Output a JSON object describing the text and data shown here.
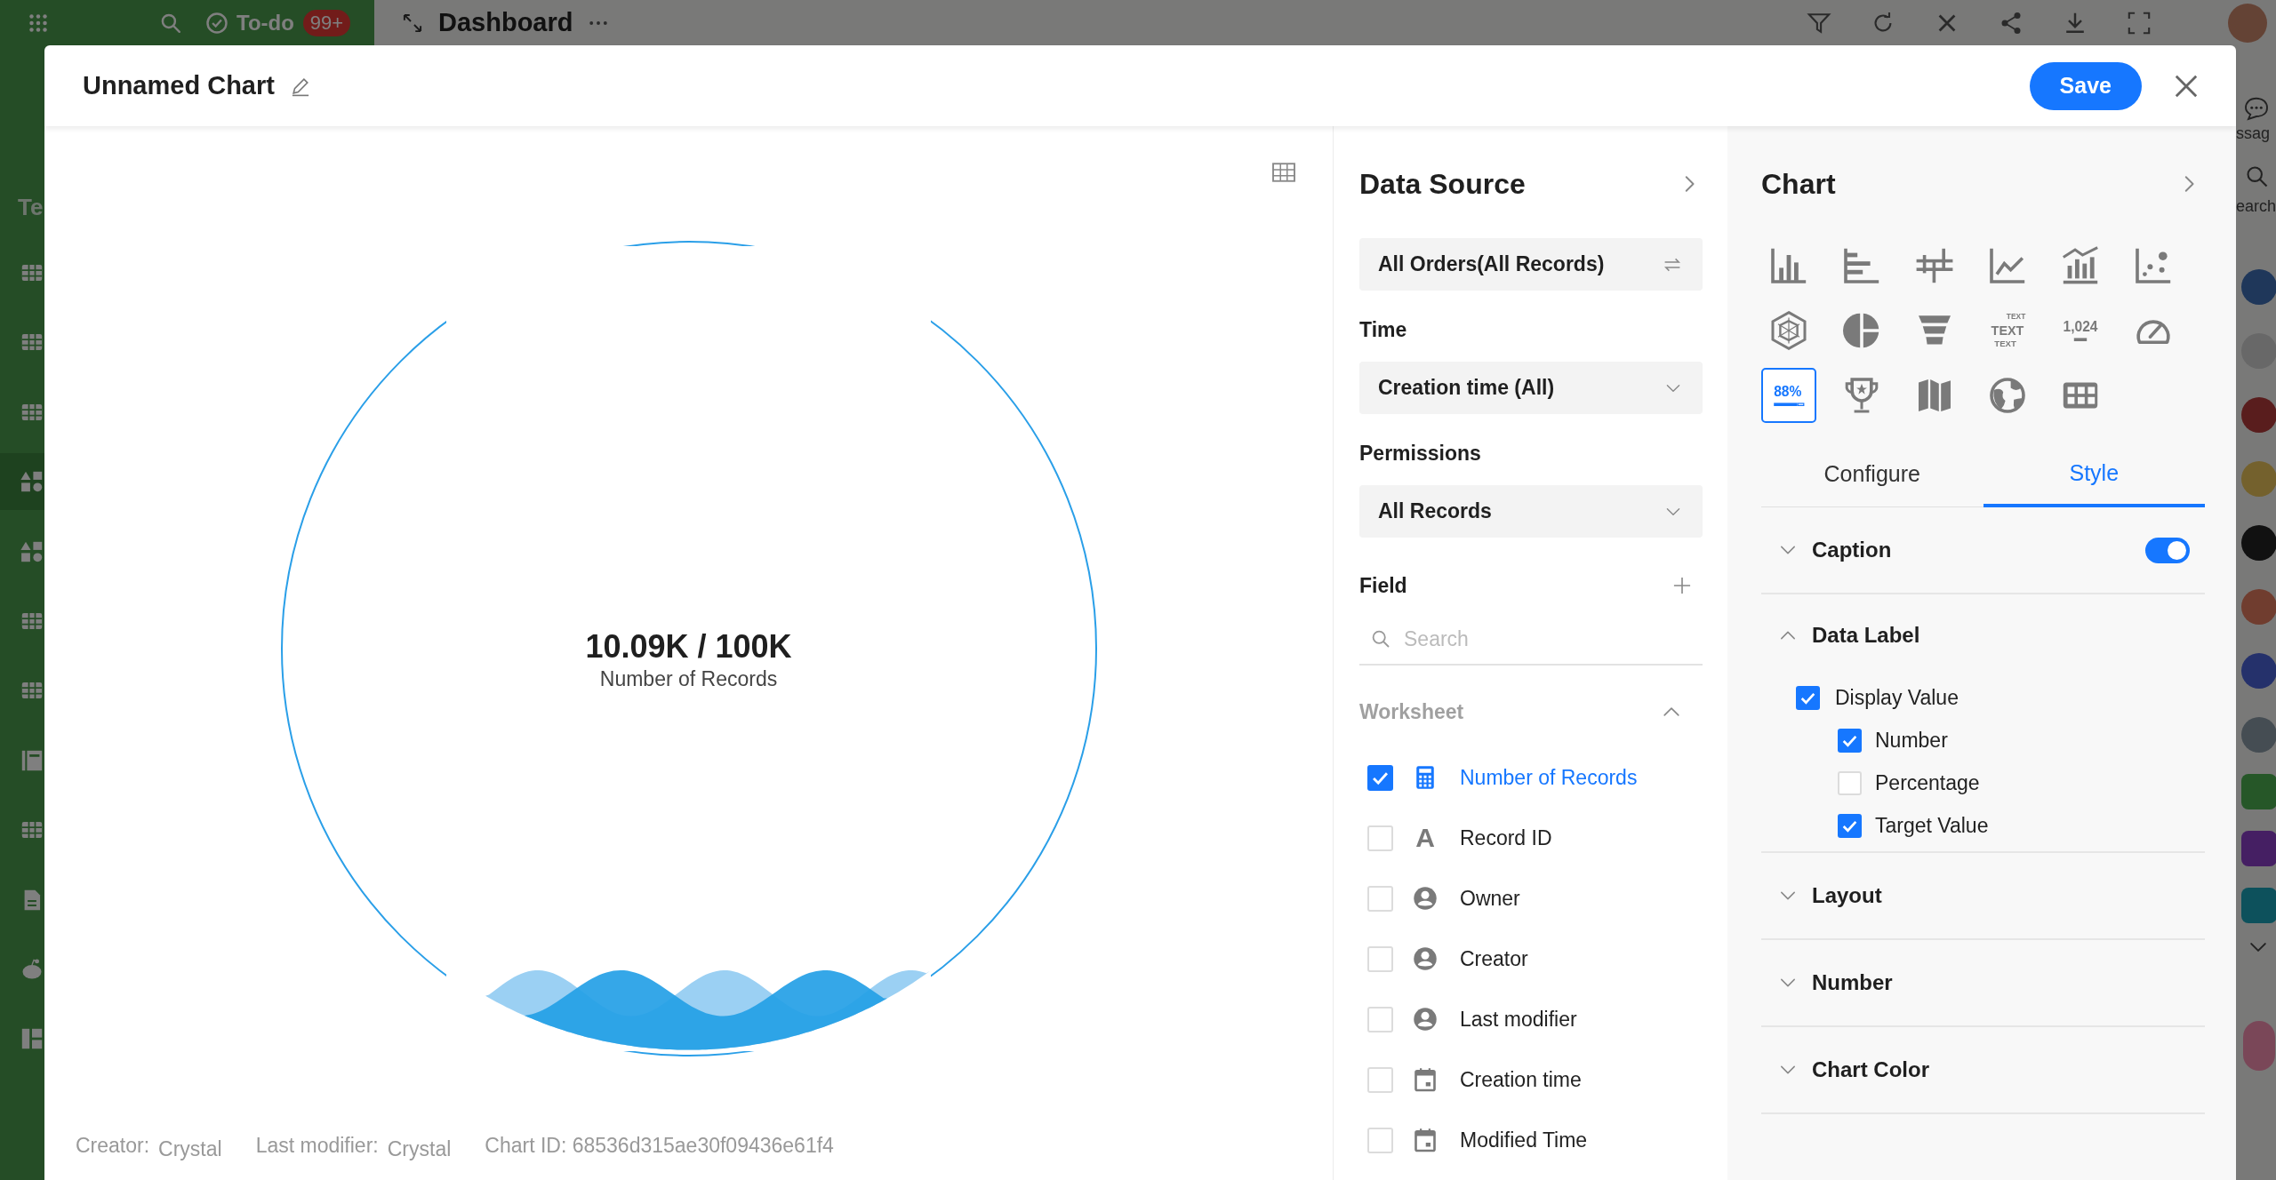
{
  "app_bar": {
    "todo": "To-do",
    "todo_badge": "99+",
    "title": "Dashboard"
  },
  "sidebar": {
    "label": "Te"
  },
  "right_rail": {
    "labels": [
      "ssag",
      "earch"
    ]
  },
  "dialog": {
    "title": "Unnamed Chart",
    "save": "Save"
  },
  "preview": {
    "value": "10.09K / 100K",
    "caption": "Number of Records",
    "level": 0.1,
    "footer": [
      {
        "label": "Creator:",
        "value": "Crystal"
      },
      {
        "label": "Last modifier:",
        "value": "Crystal"
      }
    ],
    "chart_id": "Chart ID: 68536d315ae30f09436e61f4"
  },
  "data_source": {
    "title": "Data Source",
    "source": "All Orders(All Records)",
    "filters": [
      {
        "label": "Time",
        "value": "Creation time (All)"
      },
      {
        "label": "Permissions",
        "value": "All Records"
      }
    ],
    "field_label": "Field",
    "search_placeholder": "Search",
    "group": {
      "label": "Worksheet",
      "expanded": true,
      "fields": [
        {
          "name": "Number of Records",
          "kind": "number",
          "checked": true
        },
        {
          "name": "Record ID",
          "kind": "text",
          "glyph": "A",
          "checked": false
        },
        {
          "name": "Owner",
          "kind": "user",
          "checked": false
        },
        {
          "name": "Creator",
          "kind": "user",
          "checked": false
        },
        {
          "name": "Last modifier",
          "kind": "user",
          "checked": false
        },
        {
          "name": "Creation time",
          "kind": "date",
          "checked": false
        },
        {
          "name": "Modified Time",
          "kind": "date",
          "checked": false
        }
      ]
    }
  },
  "chart_panel": {
    "title": "Chart",
    "types": [
      {
        "kind": "column",
        "selected": false
      },
      {
        "kind": "bar",
        "selected": false
      },
      {
        "kind": "waterfall",
        "selected": false
      },
      {
        "kind": "line",
        "selected": false
      },
      {
        "kind": "combo",
        "selected": false
      },
      {
        "kind": "scatter",
        "selected": false
      },
      {
        "kind": "radar",
        "selected": false
      },
      {
        "kind": "pie",
        "selected": false
      },
      {
        "kind": "funnel",
        "selected": false
      },
      {
        "kind": "word_cloud",
        "labels": [
          "TEXT",
          "TEXT",
          "TEXT"
        ],
        "selected": false
      },
      {
        "kind": "statistic",
        "label": "1,024",
        "selected": false
      },
      {
        "kind": "gauge",
        "selected": false
      },
      {
        "kind": "progress",
        "label": "88%",
        "selected": true
      },
      {
        "kind": "ranking",
        "selected": false
      },
      {
        "kind": "map",
        "selected": false
      },
      {
        "kind": "globe",
        "selected": false
      },
      {
        "kind": "table",
        "selected": false
      }
    ],
    "tabs": [
      {
        "label": "Configure",
        "selected": false
      },
      {
        "label": "Style",
        "selected": true
      }
    ],
    "sections": [
      {
        "kind": "toggle",
        "title": "Caption",
        "expanded": false,
        "on": true
      },
      {
        "kind": "options",
        "title": "Data Label",
        "expanded": true,
        "options": [
          {
            "label": "Display Value",
            "checked": true,
            "children": [
              {
                "label": "Number",
                "checked": true
              },
              {
                "label": "Percentage",
                "checked": false
              },
              {
                "label": "Target Value",
                "checked": true
              }
            ]
          }
        ]
      },
      {
        "kind": "plain",
        "title": "Layout",
        "expanded": false
      },
      {
        "kind": "plain",
        "title": "Number",
        "expanded": false
      },
      {
        "kind": "plain",
        "title": "Chart Color",
        "expanded": false
      }
    ]
  }
}
